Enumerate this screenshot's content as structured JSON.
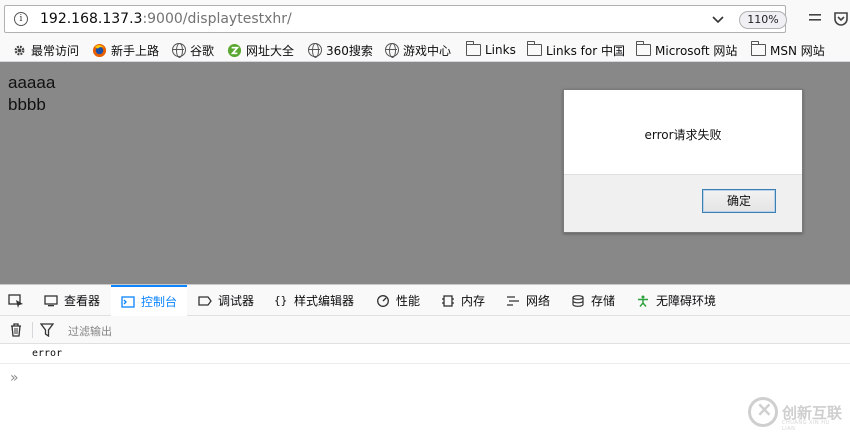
{
  "urlbar": {
    "host": "192.168.137.3",
    "path": ":9000/displaytestxhr/",
    "zoom": "110%"
  },
  "bookmarks": [
    {
      "label": "最常访问",
      "icon": "gear-icon"
    },
    {
      "label": "新手上路",
      "icon": "firefox-icon"
    },
    {
      "label": "谷歌",
      "icon": "globe-icon"
    },
    {
      "label": "网址大全",
      "icon": "site-nav-icon"
    },
    {
      "label": "360搜索",
      "icon": "globe-icon"
    },
    {
      "label": "游戏中心",
      "icon": "globe-icon"
    },
    {
      "label": "Links",
      "icon": "folder-icon"
    },
    {
      "label": "Links for 中国",
      "icon": "folder-icon"
    },
    {
      "label": "Microsoft 网站",
      "icon": "folder-icon"
    },
    {
      "label": "MSN 网站",
      "icon": "folder-icon"
    }
  ],
  "content": {
    "line1": "aaaaa",
    "line2": "bbbb"
  },
  "dialog": {
    "message": "error请求失败",
    "ok_label": "确定"
  },
  "devtools": {
    "tabs": [
      {
        "label": "查看器",
        "icon": "inspector-icon"
      },
      {
        "label": "控制台",
        "icon": "console-icon"
      },
      {
        "label": "调试器",
        "icon": "debugger-icon"
      },
      {
        "label": "样式编辑器",
        "icon": "style-editor-icon"
      },
      {
        "label": "性能",
        "icon": "performance-icon"
      },
      {
        "label": "内存",
        "icon": "memory-icon"
      },
      {
        "label": "网络",
        "icon": "network-icon"
      },
      {
        "label": "存储",
        "icon": "storage-icon"
      },
      {
        "label": "无障碍环境",
        "icon": "accessibility-icon"
      }
    ],
    "active_tab": "控制台",
    "filter_placeholder": "过滤输出",
    "log": "error",
    "prompt": "»"
  },
  "watermark": {
    "text": "创新互联",
    "sub": "CHUANG XIN HU LIAN"
  },
  "colors": {
    "accent": "#0a84ff",
    "content_bg": "#888888"
  }
}
